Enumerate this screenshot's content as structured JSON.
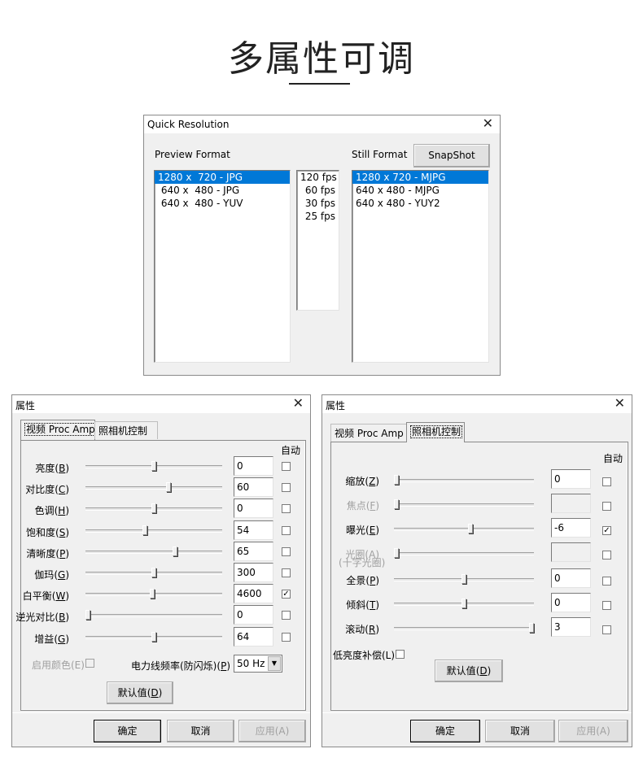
{
  "heading": "多属性可调",
  "qr": {
    "title": "Quick Resolution",
    "preview_label": "Preview Format",
    "still_label": "Still Format",
    "snapshot": "SnapShot",
    "preview_items": [
      "1280 x  720 - JPG",
      " 640 x  480 - JPG",
      " 640 x  480 - YUV"
    ],
    "fps_items": [
      "120 fps",
      "60 fps",
      "30 fps",
      "25 fps"
    ],
    "still_items": [
      "1280 x 720 - MJPG",
      "640 x 480 - MJPG",
      "640 x 480 - YUY2"
    ]
  },
  "left": {
    "title": "属性",
    "tab1": "视频 Proc Amp",
    "tab2": "照相机控制",
    "auto_label": "自动",
    "rows": [
      {
        "name": "亮度",
        "key": "B",
        "value": "0",
        "level": 0.5,
        "auto": false
      },
      {
        "name": "对比度",
        "key": "C",
        "value": "60",
        "level": 0.61,
        "auto": false
      },
      {
        "name": "色调",
        "key": "H",
        "value": "0",
        "level": 0.5,
        "auto": false
      },
      {
        "name": "饱和度",
        "key": "S",
        "value": "54",
        "level": 0.43,
        "auto": false
      },
      {
        "name": "清晰度",
        "key": "P",
        "value": "65",
        "level": 0.66,
        "auto": false
      },
      {
        "name": "伽玛",
        "key": "G",
        "value": "300",
        "level": 0.5,
        "auto": false
      },
      {
        "name": "白平衡",
        "key": "W",
        "value": "4600",
        "level": 0.49,
        "auto": true
      },
      {
        "name": "逆光对比",
        "key": "B",
        "value": "0",
        "level": 0.0,
        "auto": false
      },
      {
        "name": "增益",
        "key": "G",
        "value": "64",
        "level": 0.5,
        "auto": false
      }
    ],
    "color_enable": "启用颜色(E)",
    "powerline_label": "电力线频率(防闪烁)",
    "powerline_key": "P",
    "powerline_value": "50 Hz",
    "default_btn": "默认值",
    "default_key": "D",
    "ok": "确定",
    "cancel": "取消",
    "apply": "应用(A)"
  },
  "right": {
    "title": "属性",
    "tab1": "视频 Proc Amp",
    "tab2": "照相机控制",
    "auto_label": "自动",
    "rows": [
      {
        "name": "缩放",
        "key": "Z",
        "value": "0",
        "level": 0.0,
        "auto": false,
        "disabled": false
      },
      {
        "name": "焦点",
        "key": "F",
        "value": "",
        "level": 0.0,
        "auto": false,
        "disabled": true
      },
      {
        "name": "曝光",
        "key": "E",
        "value": "-6",
        "level": 0.55,
        "auto": true,
        "disabled": false
      },
      {
        "name": "光圈(A)",
        "key": "",
        "value": "",
        "level": 0.0,
        "auto": false,
        "disabled": true
      },
      {
        "name": "全景",
        "key": "P",
        "value": "0",
        "level": 0.5,
        "auto": false,
        "disabled": false
      },
      {
        "name": "倾斜",
        "key": "T",
        "value": "0",
        "level": 0.5,
        "auto": false,
        "disabled": false
      },
      {
        "name": "滚动",
        "key": "R",
        "value": "3",
        "level": 1.0,
        "auto": false,
        "disabled": false
      }
    ],
    "iris_sub": "(十字光圈)",
    "lowlight": "低亮度补偿(L)",
    "default_btn": "默认值",
    "default_key": "D",
    "ok": "确定",
    "cancel": "取消",
    "apply": "应用(A)"
  }
}
